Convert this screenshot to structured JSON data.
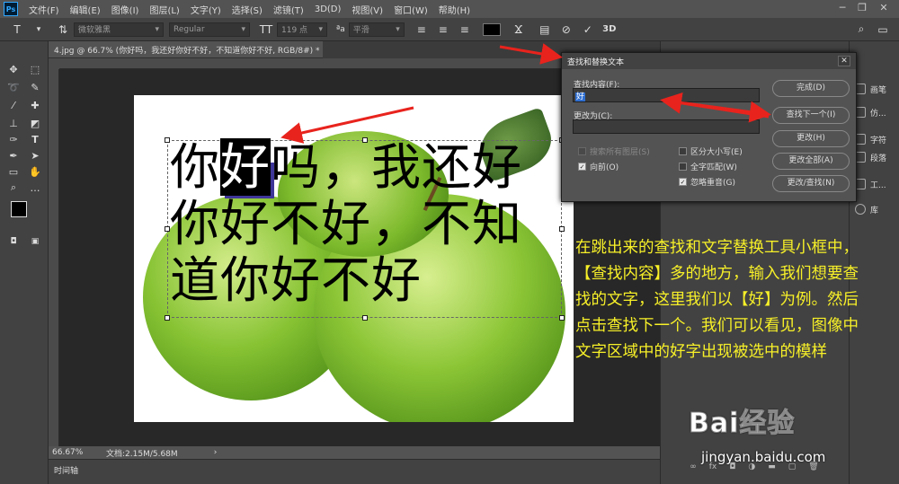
{
  "menu": {
    "logo": "Ps",
    "items": [
      "文件(F)",
      "编辑(E)",
      "图像(I)",
      "图层(L)",
      "文字(Y)",
      "选择(S)",
      "滤镜(T)",
      "3D(D)",
      "视图(V)",
      "窗口(W)",
      "帮助(H)"
    ],
    "min": "─",
    "max": "❐",
    "close": "✕"
  },
  "options": {
    "font_family": "微软雅黑",
    "font_style": "Regular",
    "font_size": "119 点",
    "aa_label": "ªa",
    "aa_value": "平滑",
    "text_color": "#000000"
  },
  "document": {
    "tab_title": "4.jpg @ 66.7% (你好吗，我还好你好不好，不知道你好不好, RGB/8#) *",
    "text_line1_pre": "你",
    "text_line1_sel": "好",
    "text_line1_post": "吗，我还好",
    "text_line2": "你好不好，不知",
    "text_line3": "道你好不好"
  },
  "status": {
    "zoom": "66.67%",
    "doc_info": "文档:2.15M/5.68M",
    "arrow": "›"
  },
  "timeline": {
    "label": "时间轴"
  },
  "dialog": {
    "title": "查找和替换文本",
    "close": "✕",
    "find_label": "查找内容(F):",
    "find_value": "好",
    "replace_label": "更改为(C):",
    "replace_value": "",
    "chk_all_layers": "搜索所有图层(S)",
    "chk_forward": "向前(O)",
    "chk_case": "区分大小写(E)",
    "chk_whole": "全字匹配(W)",
    "chk_accent": "忽略重音(G)",
    "btn_done": "完成(D)",
    "btn_find_next": "查找下一个(I)",
    "btn_change": "更改(H)",
    "btn_change_all": "更改全部(A)",
    "btn_change_find": "更改/查找(N)"
  },
  "dock": {
    "items": [
      "画笔",
      "仿...",
      "字符",
      "段落",
      "工...",
      "库"
    ]
  },
  "annotation": {
    "text": "在跳出来的查找和文字替换工具小框中，【查找内容】多的地方，输入我们想要查找的文字，这里我们以【好】为例。然后点击查找下一个。我们可以看见，图像中文字区域中的好字出现被选中的模样"
  },
  "watermark": {
    "logo": "Bai经验",
    "url": "jingyan.baidu.com"
  },
  "colors": {
    "annotation": "#f7f028",
    "arrow": "#e8231d",
    "apple": "#7fbf2a",
    "ps_blue": "#31a8ff"
  }
}
